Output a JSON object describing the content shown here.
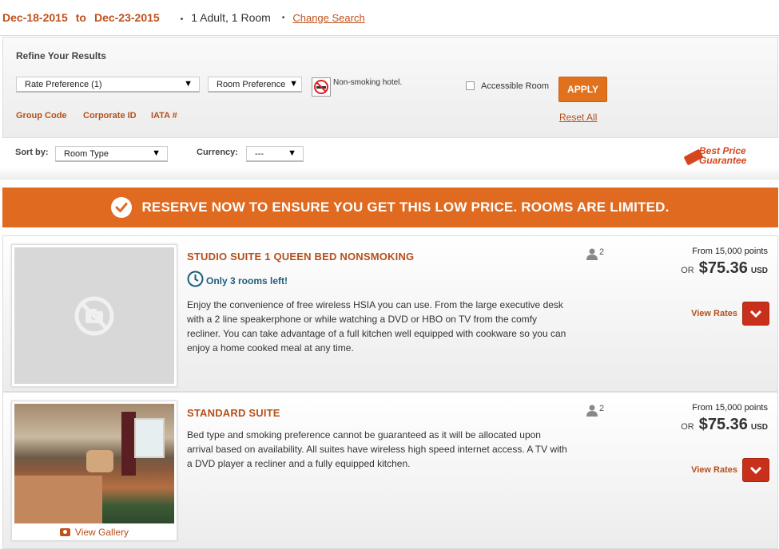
{
  "search": {
    "check_in": "Dec-18-2015",
    "to_label": "to",
    "check_out": "Dec-23-2015",
    "bullet": "•",
    "guests": "1 Adult, 1 Room",
    "change_search": "Change Search"
  },
  "refine": {
    "title": "Refine Your Results",
    "rate_preference": "Rate Preference (1)",
    "room_preference": "Room Preference",
    "nonsmoking_label": "Non-smoking hotel.",
    "accessible_label": "Accessible Room",
    "apply_label": "APPLY",
    "group_code": "Group Code",
    "corporate_id": "Corporate ID",
    "iata": "IATA #",
    "reset_all": "Reset All"
  },
  "sort": {
    "sort_label": "Sort by:",
    "sort_value": "Room Type",
    "currency_label": "Currency:",
    "currency_value": "---",
    "badge_line1": "Best Price",
    "badge_line2": "Guarantee"
  },
  "banner": {
    "text": "RESERVE NOW TO ENSURE YOU GET THIS LOW PRICE. ROOMS ARE LIMITED."
  },
  "rooms": [
    {
      "title": "STUDIO SUITE 1 QUEEN BED NONSMOKING",
      "availability": "Only 3 rooms left!",
      "description": "Enjoy the convenience of free wireless HSIA you can use. From the large executive desk with a 2 line speakerphone or while watching a DVD or HBO on TV from the comfy recliner. You can take advantage of a full kitchen well equipped with cookware so you can enjoy a home cooked meal at any time.",
      "occupancy": "2",
      "points": "From 15,000 points",
      "or": "OR",
      "price": "$75.36",
      "currency": "USD",
      "view_rates": "View Rates"
    },
    {
      "title": "STANDARD SUITE",
      "description": "Bed type and smoking preference cannot be guaranteed as it will be allocated upon arrival based on availability. All suites have wireless high speed internet access. A TV with a DVD player a recliner and a fully equipped kitchen.",
      "occupancy": "2",
      "points": "From 15,000 points",
      "or": "OR",
      "price": "$75.36",
      "currency": "USD",
      "view_rates": "View Rates",
      "gallery": "View Gallery"
    }
  ],
  "colors": {
    "accent_orange": "#e06a1f",
    "link_brown": "#b5501a",
    "view_rates_red": "#c9301b",
    "availability_blue": "#1f5e7a"
  }
}
